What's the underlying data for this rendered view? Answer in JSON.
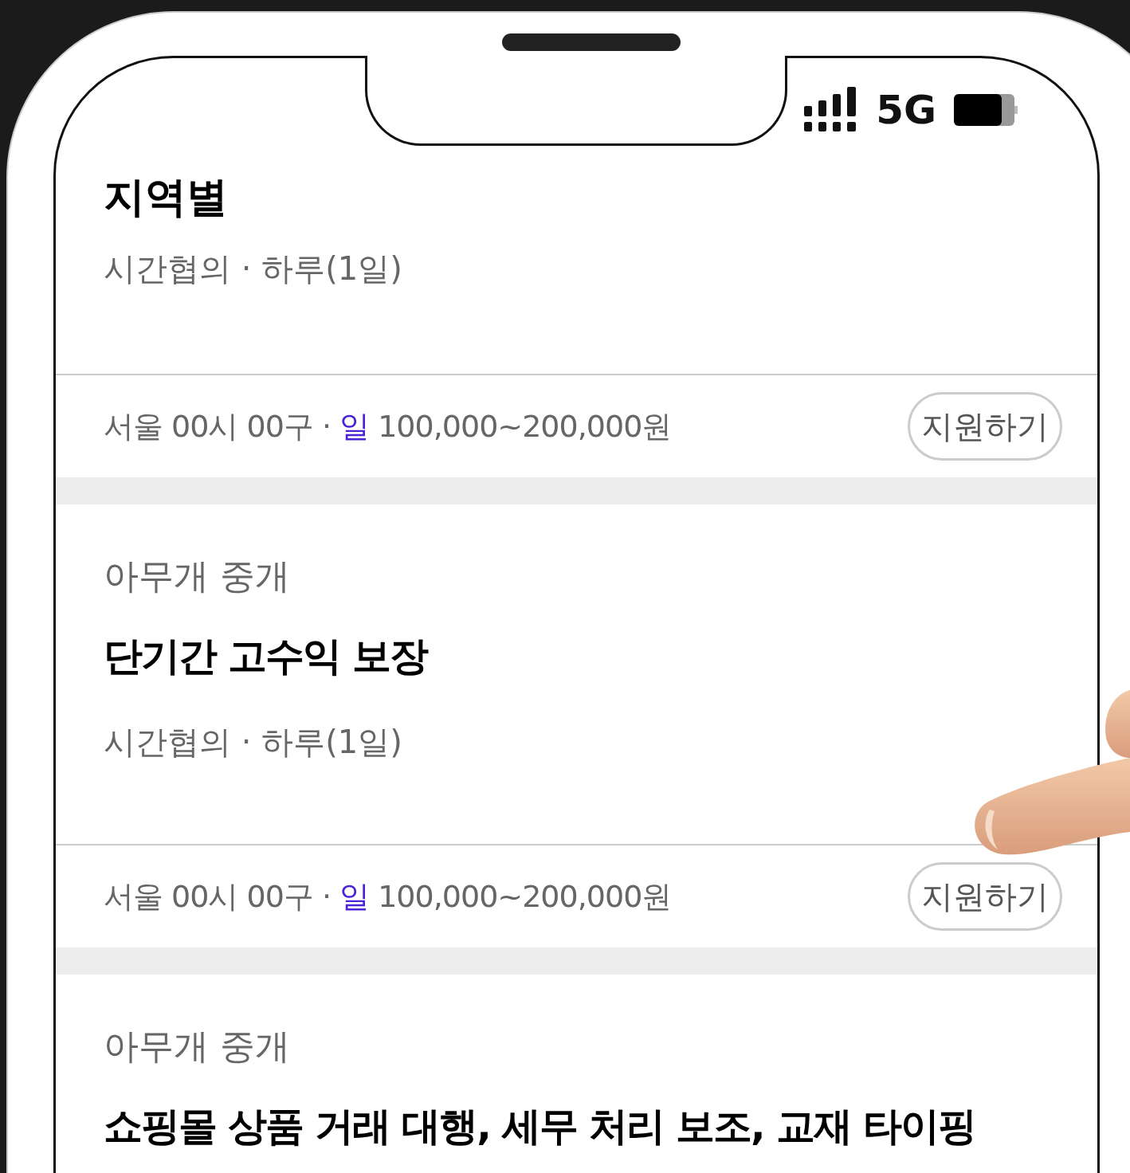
{
  "status_bar": {
    "network": "5G"
  },
  "header": {
    "title": "지역별"
  },
  "jobs": [
    {
      "meta": "시간협의 · 하루(1일)",
      "location": "서울 00시 00구 ·",
      "pay_type": "일",
      "pay": "100,000~200,000원",
      "apply": "지원하기"
    },
    {
      "company": "아무개 중개",
      "title": "단기간 고수익 보장",
      "meta": "시간협의 · 하루(1일)",
      "location": "서울 00시 00구 ·",
      "pay_type": "일",
      "pay": "100,000~200,000원",
      "apply": "지원하기"
    },
    {
      "company": "아무개 중개",
      "title": "쇼핑몰 상품 거래 대행, 세무 처리 보조, 교재 타이핑"
    }
  ]
}
